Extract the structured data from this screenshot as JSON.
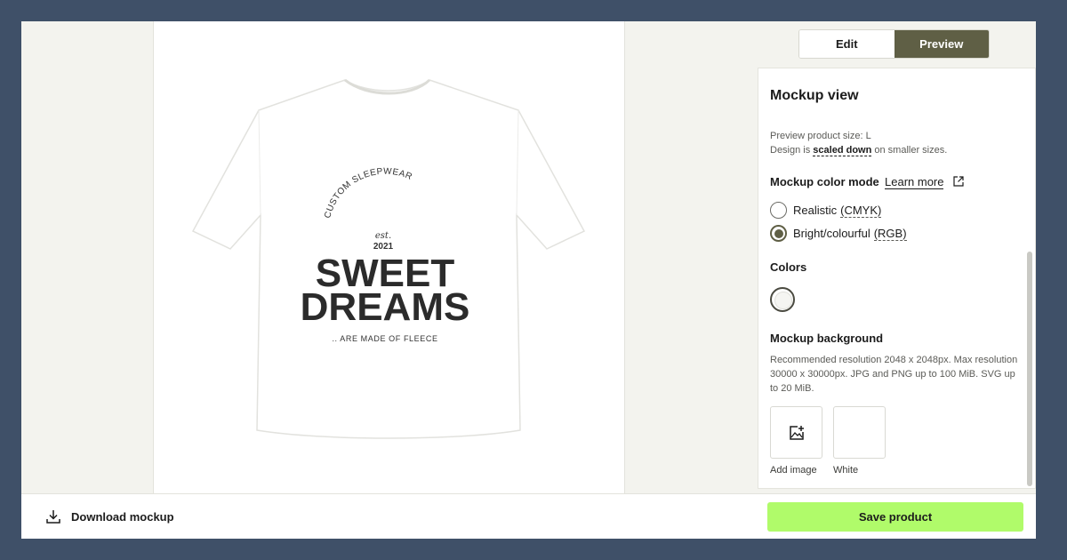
{
  "toggle": {
    "edit_label": "Edit",
    "preview_label": "Preview",
    "active": "Preview"
  },
  "design": {
    "arc_text": "CUSTOM SLEEPWEAR",
    "est_label": "est.",
    "year": "2021",
    "line1": "SWEET",
    "line2": "DREAMS",
    "tagline": ".. ARE MADE OF FLEECE"
  },
  "panel": {
    "title": "Mockup view",
    "preview_size_text": "Preview product size: L",
    "design_prefix": "Design is ",
    "design_link": "scaled down",
    "design_suffix": " on smaller sizes.",
    "color_mode_label": "Mockup color mode",
    "learn_more": "Learn more",
    "options": [
      {
        "label": "Realistic",
        "code": "(CMYK)",
        "selected": false
      },
      {
        "label": "Bright/colourful",
        "code": "(RGB)",
        "selected": true
      }
    ],
    "colors_label": "Colors",
    "selected_color": "#f5f5f2",
    "background_label": "Mockup background",
    "background_desc": "Recommended resolution 2048 x 2048px. Max resolution 30000 x 30000px. JPG and PNG up to 100 MiB. SVG up to 20 MiB.",
    "tiles": [
      {
        "label": "Add image",
        "icon": "add-image-icon"
      },
      {
        "label": "White",
        "icon": ""
      }
    ]
  },
  "footer": {
    "download_label": "Download mockup",
    "save_label": "Save product"
  },
  "colors": {
    "accent": "#5f5f45",
    "save": "#b0fb6a",
    "frame": "#3f5068"
  }
}
